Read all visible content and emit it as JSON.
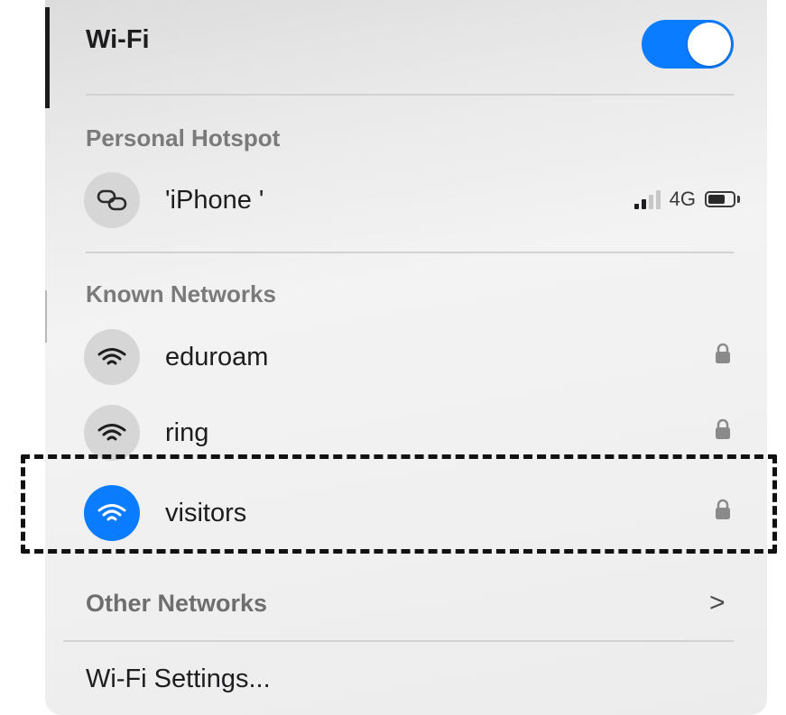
{
  "wifi": {
    "title": "Wi-Fi",
    "enabled": true,
    "accent_color": "#0a7cff"
  },
  "personal_hotspot": {
    "label": "Personal Hotspot",
    "device": {
      "name": "'iPhone '",
      "icon": "link-icon",
      "signal_bars": 2,
      "network_type": "4G",
      "battery_level": 0.7
    }
  },
  "known_networks": {
    "label": "Known Networks",
    "items": [
      {
        "name": "eduroam",
        "icon": "wifi-icon",
        "secured": true,
        "connected": false
      },
      {
        "name": "ring",
        "icon": "wifi-icon",
        "secured": true,
        "connected": false
      },
      {
        "name": "visitors",
        "icon": "wifi-icon",
        "secured": true,
        "connected": true
      }
    ]
  },
  "other_networks": {
    "label": "Other Networks",
    "chevron": ">"
  },
  "settings": {
    "label": "Wi-Fi Settings..."
  }
}
